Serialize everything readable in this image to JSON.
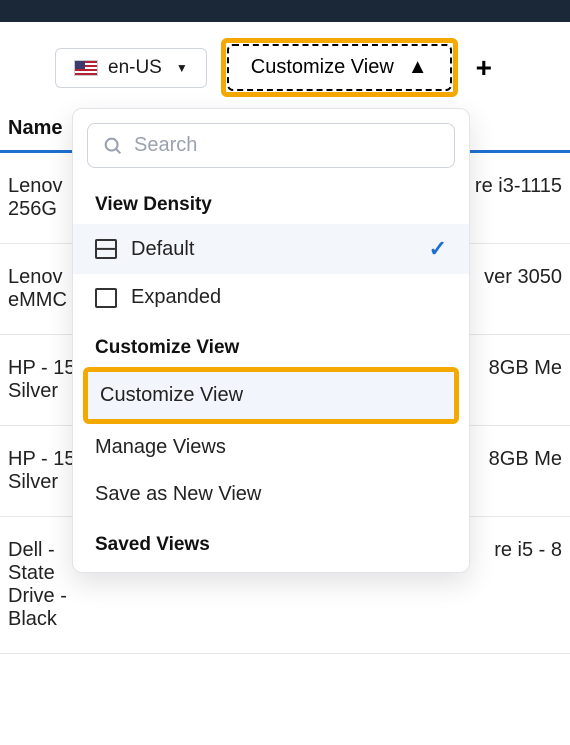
{
  "toolbar": {
    "locale_label": "en-US",
    "customize_button": "Customize View",
    "plus_label": "+"
  },
  "table": {
    "header": {
      "name": "Name"
    },
    "rows": [
      {
        "left": "Lenov\n256G",
        "right": "re i3-1115"
      },
      {
        "left": "Lenov\neMMC",
        "right": "ver 3050"
      },
      {
        "left": "HP - 15\nSilver",
        "right": "8GB Me"
      },
      {
        "left": "HP - 15\nSilver",
        "right": "8GB Me"
      },
      {
        "left": "Dell -\nState Drive - Black",
        "right": "re i5 - 8"
      }
    ]
  },
  "panel": {
    "search_placeholder": "Search",
    "sections": {
      "view_density": {
        "title": "View Density",
        "options": [
          {
            "label": "Default",
            "selected": true
          },
          {
            "label": "Expanded",
            "selected": false
          }
        ]
      },
      "customize_view": {
        "title": "Customize View",
        "items": [
          {
            "label": "Customize View",
            "highlighted": true
          },
          {
            "label": "Manage Views"
          },
          {
            "label": "Save as New View"
          }
        ]
      },
      "saved_views": {
        "title": "Saved Views"
      }
    }
  }
}
